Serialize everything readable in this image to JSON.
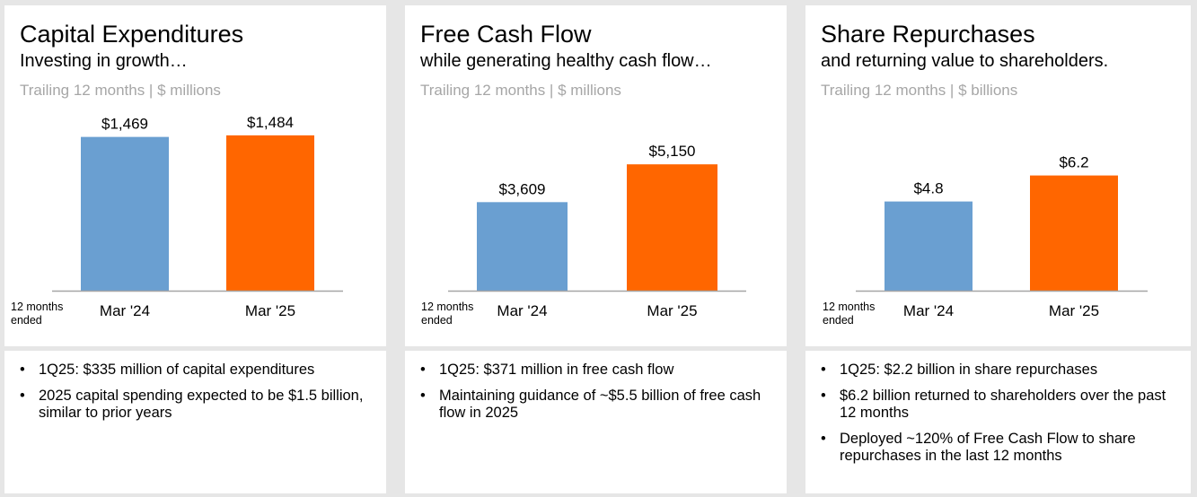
{
  "panels": [
    {
      "title": "Capital Expenditures",
      "subtitle": "Investing in growth…",
      "units": "Trailing 12 months | $ millions",
      "period_label_1": "12 months",
      "period_label_2": "ended",
      "bullets": [
        "1Q25: $335 million of capital expenditures",
        "2025 capital spending expected to be $1.5 billion, similar to prior years"
      ]
    },
    {
      "title": "Free Cash Flow",
      "subtitle": "while generating healthy cash flow…",
      "units": "Trailing 12 months | $ millions",
      "period_label_1": "12 months",
      "period_label_2": "ended",
      "bullets": [
        "1Q25: $371 million in free cash flow",
        "Maintaining guidance of ~$5.5 billion of free cash flow in 2025"
      ]
    },
    {
      "title": "Share Repurchases",
      "subtitle": "and returning value to shareholders.",
      "units": "Trailing 12 months | $ billions",
      "period_label_1": "12 months",
      "period_label_2": "ended",
      "bullets": [
        "1Q25: $2.2 billion in share repurchases",
        "$6.2 billion returned to shareholders over the past 12 months",
        "Deployed ~120% of Free Cash Flow to share repurchases in the last 12 months"
      ]
    }
  ],
  "colors": {
    "prior": "#6a9fd1",
    "current": "#ff6600",
    "axis": "#a6a6a6"
  },
  "chart_data": [
    {
      "type": "bar",
      "title": "Capital Expenditures",
      "categories": [
        "Mar '24",
        "Mar '25"
      ],
      "values": [
        1469,
        1484
      ],
      "data_labels": [
        "$1,469",
        "$1,484"
      ],
      "ylim": [
        0,
        1500
      ],
      "grid": false
    },
    {
      "type": "bar",
      "title": "Free Cash Flow",
      "categories": [
        "Mar '24",
        "Mar '25"
      ],
      "values": [
        3609,
        5150
      ],
      "data_labels": [
        "$3,609",
        "$5,150"
      ],
      "ylim": [
        0,
        6400
      ],
      "grid": false
    },
    {
      "type": "bar",
      "title": "Share Repurchases",
      "categories": [
        "Mar '24",
        "Mar '25"
      ],
      "values": [
        4.8,
        6.2
      ],
      "data_labels": [
        "$4.8",
        "$6.2"
      ],
      "ylim": [
        0,
        8.45
      ],
      "grid": false
    }
  ]
}
